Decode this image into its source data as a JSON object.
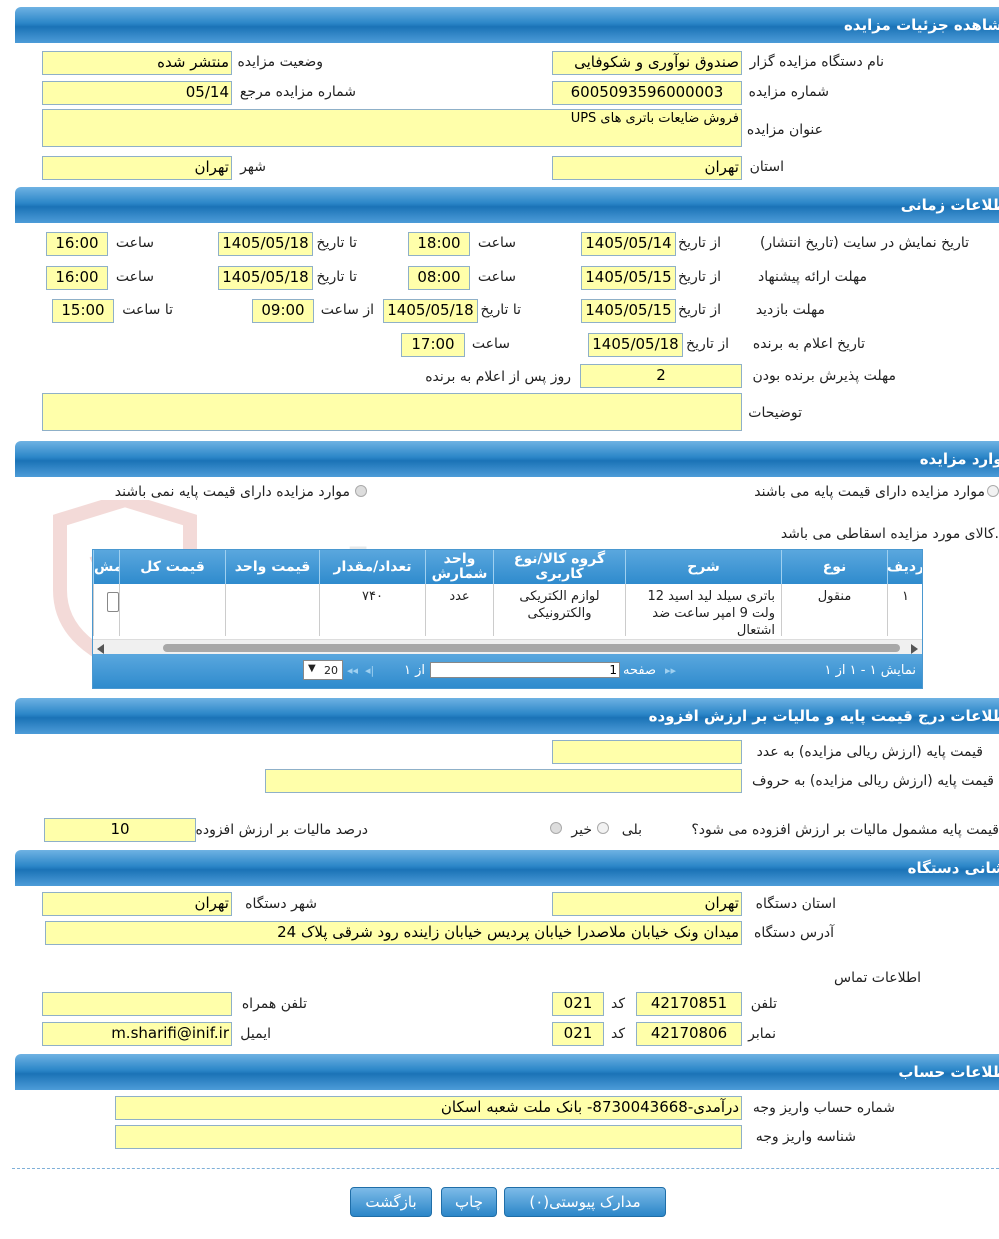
{
  "sections": {
    "details": "مشاهده جزئیات مزایده",
    "timing": "اطلاعات زمانی",
    "items": "موارد مزایده",
    "pricing": "اطلاعات درج قیمت پایه و مالیات بر ارزش افزوده",
    "address": "نشانی دستگاه",
    "account": "اطلاعات حساب"
  },
  "details": {
    "org_label": "نام دستگاه مزایده گزار",
    "org_value": "صندوق نوآوری و شکوفایی",
    "status_label": "وضعیت مزایده",
    "status_value": "منتشر شده",
    "number_label": "شماره مزایده",
    "number_value": "6005093596000003",
    "ref_label": "شماره مزایده مرجع",
    "ref_value": "05/14",
    "title_label": "عنوان مزایده",
    "title_value": "فروش ضایعات باتری های UPS",
    "province_label": "استان",
    "province_value": "تهران",
    "city_label": "شهر",
    "city_value": "تهران"
  },
  "timing": {
    "display_label": "تاریخ نمایش در سایت (تاریخ انتشار)",
    "offer_label": "مهلت ارائه پیشنهاد",
    "visit_label": "مهلت بازدید",
    "announce_label": "تاریخ اعلام به برنده",
    "accept_label": "مهلت پذیرش برنده بودن",
    "notes_label": "توضیحات",
    "from_date": "از تاریخ",
    "to_date": "تا تاریخ",
    "hour": "ساعت",
    "from_hour": "از ساعت",
    "to_hour": "تا ساعت",
    "days_after": "روز پس از اعلام به برنده",
    "display": {
      "from_date": "1405/05/14",
      "from_time": "18:00",
      "to_date": "1405/05/18",
      "to_time": "16:00"
    },
    "offer": {
      "from_date": "1405/05/15",
      "from_time": "08:00",
      "to_date": "1405/05/18",
      "to_time": "16:00"
    },
    "visit": {
      "from_date": "1405/05/15",
      "to_date": "1405/05/18",
      "from_time": "09:00",
      "to_time": "15:00"
    },
    "announce": {
      "from_date": "1405/05/18",
      "time": "17:00"
    },
    "accept_days": "2",
    "notes": ""
  },
  "items": {
    "radio_has_base": "موارد مزایده دارای قیمت پایه می باشند",
    "radio_no_base": "موارد مزایده دارای قیمت پایه نمی باشند",
    "scrap_note": "کالای مورد مزایده اسقاطی می باشد.",
    "columns": [
      "ردیف",
      "نوع",
      "شرح",
      "گروه کالا/نوع کاربری",
      "واحد شمارش",
      "تعداد/مقدار",
      "قیمت واحد",
      "قیمت کل",
      "مش"
    ],
    "rows": [
      {
        "row": "۱",
        "type": "منقول",
        "desc": "باتری سیلد لید اسید 12 ولت 9 امپر ساعت ضد اشتعال",
        "group": "لوازم الکتریکی والکترونیکی",
        "unit": "عدد",
        "qty": "۷۴۰",
        "unit_price": "",
        "total": ""
      }
    ],
    "pager": {
      "showing": "نمایش ۱ - ۱ از ۱",
      "page": "صفحه",
      "page_value": "1",
      "of": "از ۱",
      "page_size": "20"
    }
  },
  "pricing": {
    "base_num_label": "قیمت پایه (ارزش ریالی مزایده) به عدد",
    "base_num_value": "",
    "base_text_label": "قیمت پایه (ارزش ریالی مزایده) به حروف",
    "base_text_value": "",
    "vat_question": "قیمت پایه مشمول مالیات بر ارزش افزوده می شود؟",
    "yes": "بلی",
    "no": "خیر",
    "vat_pct_label": "درصد مالیات بر ارزش افزوده",
    "vat_pct_value": "10"
  },
  "address": {
    "province_label": "استان دستگاه",
    "province_value": "تهران",
    "city_label": "شهر دستگاه",
    "city_value": "تهران",
    "addr_label": "آدرس دستگاه",
    "addr_value": "میدان ونک خیابان ملاصدرا خیابان پردیس خیابان زاینده رود شرقی پلاک 24",
    "contact_label": "اطلاعات تماس",
    "phone_label": "تلفن",
    "phone_value": "42170851",
    "code_label": "کد",
    "phone_code": "021",
    "mobile_label": "تلفن همراه",
    "mobile_value": "",
    "fax_label": "نمابر",
    "fax_value": "42170806",
    "fax_code": "021",
    "email_label": "ایمیل",
    "email_value": "m.sharifi@inif.ir"
  },
  "account": {
    "acct_label": "شماره حساب واریز وجه",
    "acct_value": "درآمدی-8730043668- بانک ملت شعبه اسکان",
    "id_label": "شناسه واریز وجه",
    "id_value": ""
  },
  "buttons": {
    "attachments": "مدارک پیوستی(۰)",
    "print": "چاپ",
    "back": "بازگشت"
  }
}
